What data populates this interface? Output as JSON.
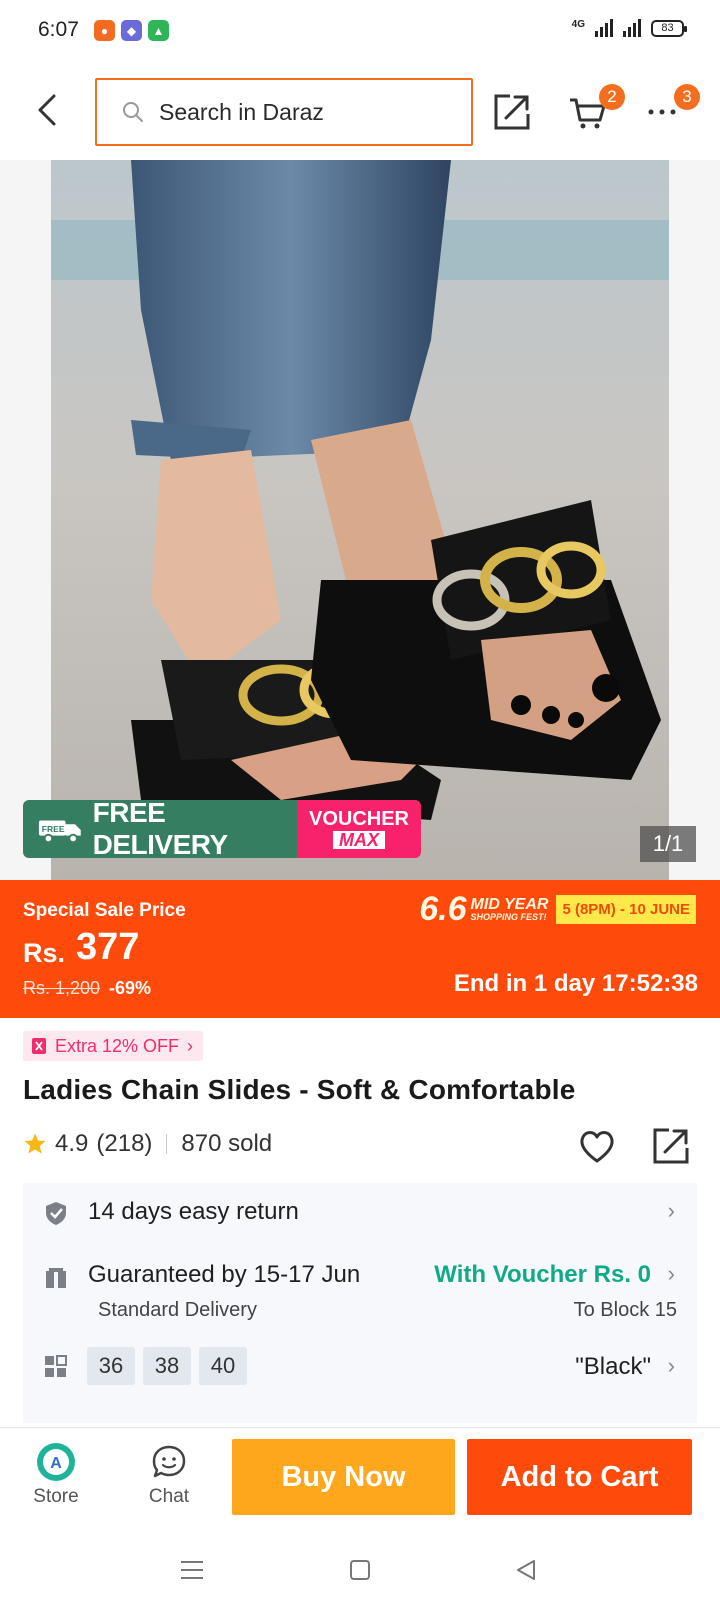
{
  "status_bar": {
    "time": "6:07",
    "network": "4G",
    "battery": "83"
  },
  "header": {
    "search_placeholder": "Search in Daraz",
    "cart_badge": "2",
    "more_badge": "3"
  },
  "gallery": {
    "promo_free_delivery": "FREE DELIVERY",
    "promo_free_tag": "FREE",
    "promo_voucher_1": "VOUCHER",
    "promo_voucher_2": "MAX",
    "counter": "1/1"
  },
  "price": {
    "label": "Special Sale Price",
    "currency": "Rs.",
    "value": "377",
    "original": "Rs. 1,200",
    "discount": "-69%",
    "campaign_big": "6.6",
    "campaign_mid": "MID YEAR",
    "campaign_small": "SHOPPING FEST!",
    "campaign_dates": "5 (8PM) - 10 JUNE",
    "countdown": "End in 1 day 17:52:38"
  },
  "product": {
    "extra_off": "Extra 12% OFF",
    "title": "Ladies Chain Slides - Soft & Comfortable",
    "rating": "4.9",
    "reviews": "(218)",
    "sold": "870 sold"
  },
  "info": {
    "return": "14 days easy return",
    "delivery": "Guaranteed by 15-17 Jun",
    "delivery_voucher": "With Voucher Rs. 0",
    "delivery_type": "Standard Delivery",
    "delivery_location": "To Block 15",
    "sizes": [
      "36",
      "38",
      "40"
    ],
    "color": "\"Black\""
  },
  "actions": {
    "store": "Store",
    "chat": "Chat",
    "buy_now": "Buy Now",
    "add_to_cart": "Add to Cart"
  },
  "colors": {
    "accent_orange": "#fe4a0a",
    "buy_yellow": "#fea71d",
    "free_green": "#357e61",
    "voucher_pink": "#f7226b"
  }
}
